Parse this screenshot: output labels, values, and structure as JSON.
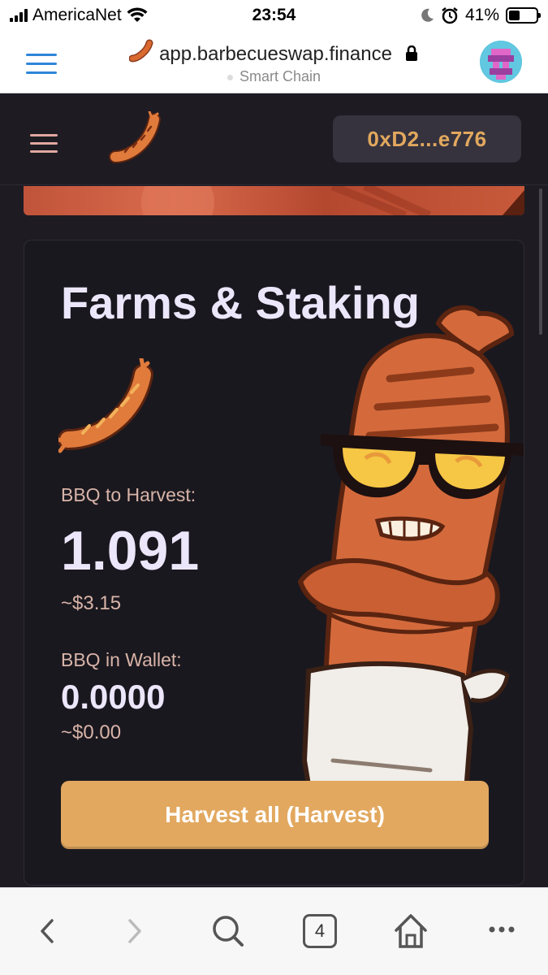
{
  "status_bar": {
    "carrier": "AmericaNet",
    "time": "23:54",
    "battery": "41%",
    "battery_level": 0.41
  },
  "browser": {
    "url": "app.barbecueswap.finance",
    "network": "Smart Chain",
    "tab_count": "4"
  },
  "header": {
    "wallet_address": "0xD2...e776"
  },
  "card": {
    "title": "Farms & Staking",
    "harvest_label": "BBQ to Harvest:",
    "harvest_amount": "1.091",
    "harvest_usd": "~$3.15",
    "wallet_label": "BBQ in Wallet:",
    "wallet_amount": "0.0000",
    "wallet_usd": "~$0.00",
    "button_label": "Harvest all (Harvest)"
  },
  "icons": {
    "browser_menu": "hamburger-icon",
    "app_menu": "hamburger-icon",
    "logo": "sausage-icon",
    "back": "chevron-left-icon",
    "forward": "chevron-right-icon",
    "search": "search-icon",
    "home": "home-icon",
    "more": "more-icon"
  },
  "colors": {
    "background": "#1e1b23",
    "card": "#1a181f",
    "accent": "#e2a85f",
    "title_text": "#ece6fb",
    "label_text": "#d8b4a8",
    "wallet_button": "#36333e"
  }
}
